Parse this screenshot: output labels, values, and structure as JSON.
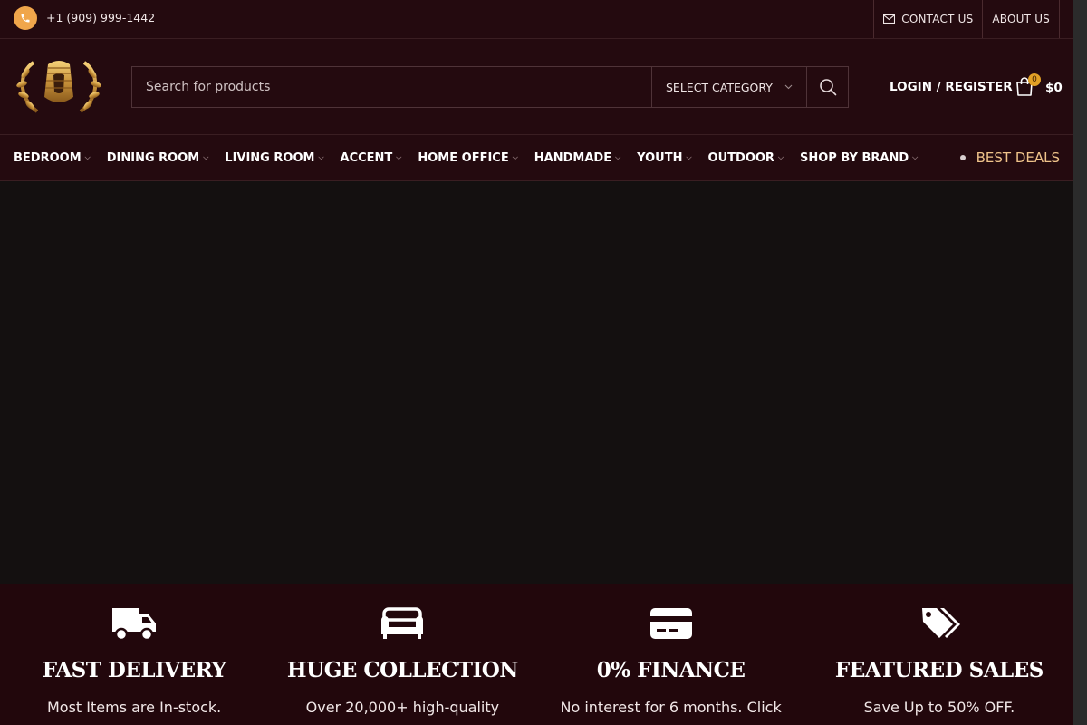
{
  "topbar": {
    "phone": "+1 (909) 999-1442",
    "contact_label": "CONTACT US",
    "about_label": "ABOUT US"
  },
  "header": {
    "search_placeholder": "Search for products",
    "category_label": "SELECT CATEGORY",
    "login_label": "LOGIN / REGISTER",
    "cart_count": "0",
    "cart_total": "$0"
  },
  "nav": {
    "items": [
      "BEDROOM",
      "DINING ROOM",
      "LIVING ROOM",
      "ACCENT",
      "HOME OFFICE",
      "HANDMADE",
      "YOUTH",
      "OUTDOOR",
      "SHOP BY BRAND"
    ],
    "best_deals": "BEST DEALS"
  },
  "features": [
    {
      "icon": "truck-icon",
      "title": "FAST DELIVERY",
      "desc": "Most Items are In-stock."
    },
    {
      "icon": "sofa-icon",
      "title": "HUGE COLLECTION",
      "desc": "Over 20,000+ high-quality"
    },
    {
      "icon": "credit-card-icon",
      "title": "0% FINANCE",
      "desc": "No interest for 6 months. Click"
    },
    {
      "icon": "tags-icon",
      "title": "FEATURED SALES",
      "desc": "Save Up to 50% OFF."
    }
  ],
  "colors": {
    "header_bg": "#240a0f",
    "accent": "#f0a64b",
    "best_deals": "#f0c48b",
    "hero_bg": "#141010"
  }
}
